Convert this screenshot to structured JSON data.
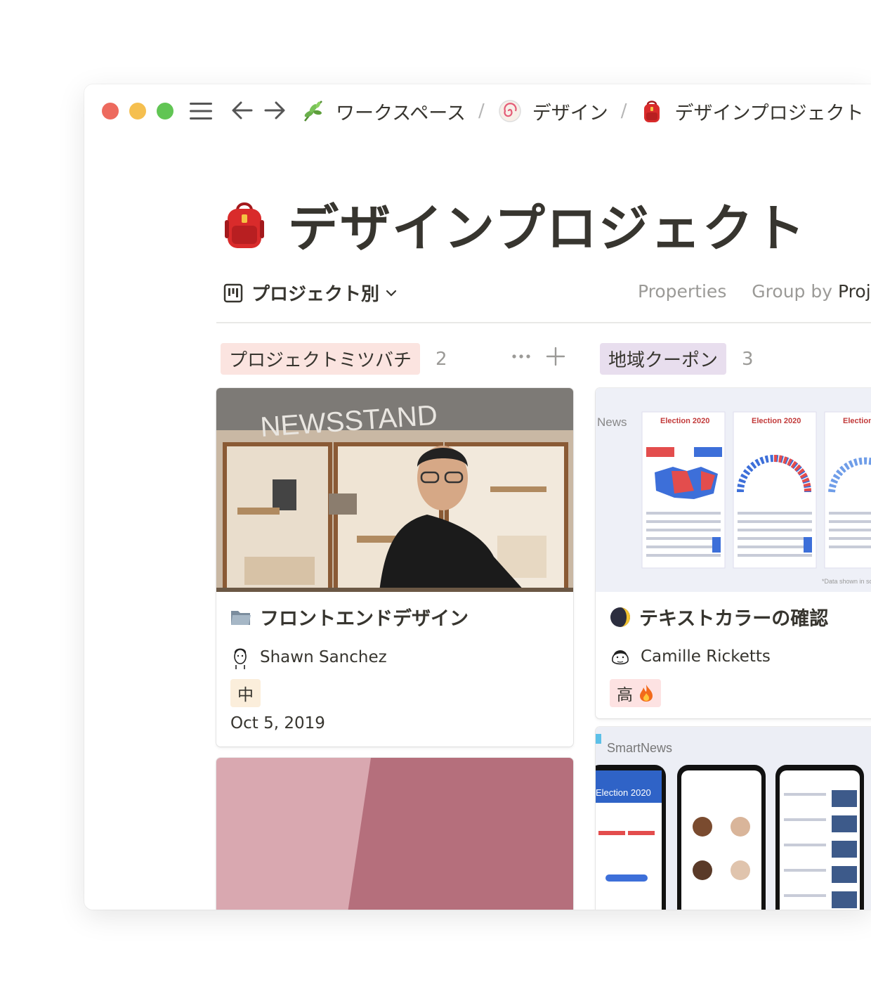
{
  "titlebar": {
    "breadcrumbs": [
      {
        "icon": "herb-icon",
        "label": "ワークスペース"
      },
      {
        "icon": "fishcake-icon",
        "label": "デザイン"
      },
      {
        "icon": "backpack-icon",
        "label": "デザインプロジェクト"
      }
    ],
    "separator": "/"
  },
  "page": {
    "icon": "backpack-icon",
    "title": "デザインプロジェクト"
  },
  "view": {
    "name": "プロジェクト別",
    "properties_label": "Properties",
    "group_by_label": "Group by",
    "group_by_value": "Proje"
  },
  "columns": [
    {
      "label": "プロジェクトミツバチ",
      "count": "2",
      "color": "#fbe4e0",
      "cards": [
        {
          "cover_text": "NEWSSTAND",
          "icon": "folder-icon",
          "title": "フロントエンドデザイン",
          "person": "Shawn Sanchez",
          "priority": "中",
          "date": "Oct 5, 2019"
        },
        {
          "cover": "pink-paper"
        }
      ]
    },
    {
      "label": "地域クーポン",
      "count": "3",
      "color": "#e8deee",
      "cards": [
        {
          "cover_brand": "News",
          "cover_headlines": [
            "Election 2020",
            "Election 2020",
            "Election"
          ],
          "cover_note": "*Data shown in sc",
          "icon": "moon-icon",
          "title": "テキストカラーの確認",
          "person": "Camille Ricketts",
          "priority": "高",
          "priority_icon": "fire-icon"
        },
        {
          "cover_brand": "SmartNews",
          "cover_headlines": [
            "Election 2020"
          ]
        }
      ]
    }
  ]
}
